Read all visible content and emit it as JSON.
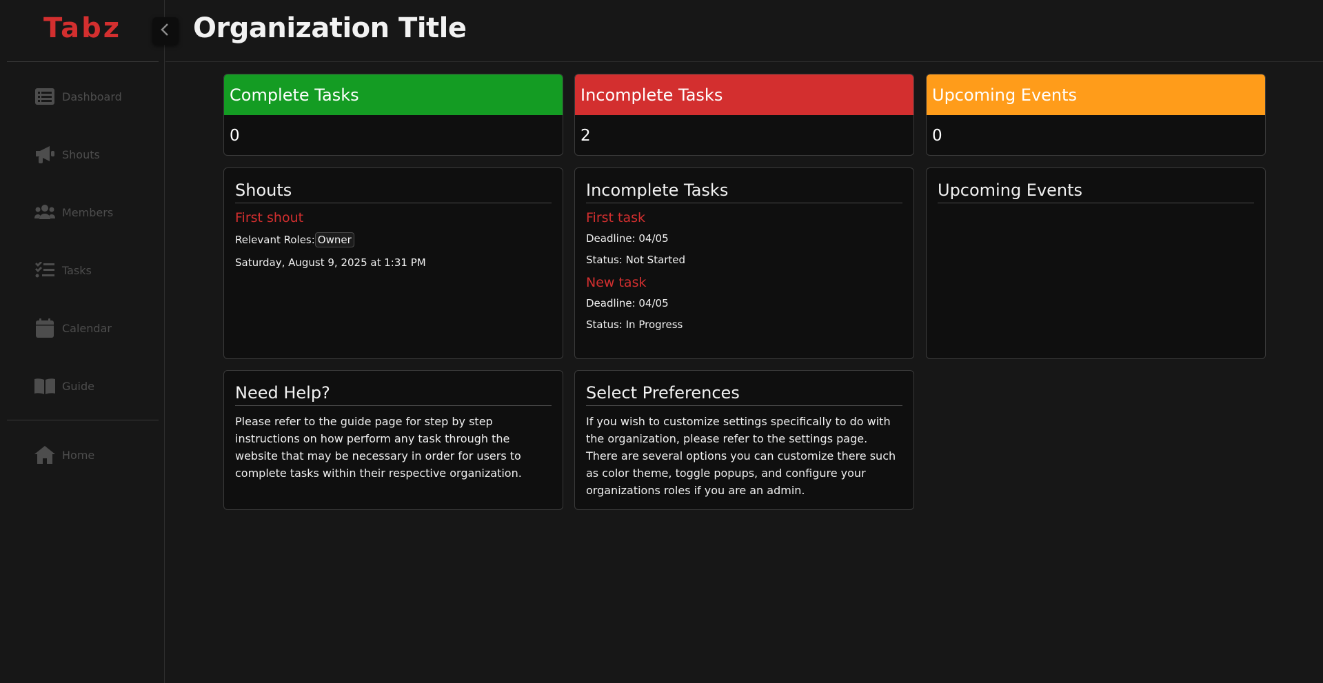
{
  "brand": "Tabz",
  "header": {
    "title": "Organization Title"
  },
  "sidebar": {
    "items": [
      {
        "label": "Dashboard",
        "icon": "list-icon"
      },
      {
        "label": "Shouts",
        "icon": "megaphone-icon"
      },
      {
        "label": "Members",
        "icon": "users-icon"
      },
      {
        "label": "Tasks",
        "icon": "checklist-icon"
      },
      {
        "label": "Calendar",
        "icon": "calendar-icon"
      },
      {
        "label": "Guide",
        "icon": "book-icon"
      }
    ],
    "home": {
      "label": "Home",
      "icon": "home-icon"
    }
  },
  "stats": [
    {
      "title": "Complete Tasks",
      "value": "0",
      "color": "#149c23"
    },
    {
      "title": "Incomplete Tasks",
      "value": "2",
      "color": "#d32f2f"
    },
    {
      "title": "Upcoming Events",
      "value": "0",
      "color": "#ff9c1a"
    }
  ],
  "shouts_panel": {
    "title": "Shouts",
    "items": [
      {
        "title": "First shout",
        "roles_label": "Relevant Roles:",
        "role": "Owner",
        "date": "Saturday, August 9, 2025 at 1:31 PM"
      }
    ]
  },
  "tasks_panel": {
    "title": "Incomplete Tasks",
    "items": [
      {
        "title": "First task",
        "deadline": "Deadline: 04/05",
        "status": "Status: Not Started"
      },
      {
        "title": "New task",
        "deadline": "Deadline: 04/05",
        "status": "Status: In Progress"
      }
    ]
  },
  "events_panel": {
    "title": "Upcoming Events"
  },
  "help_panel": {
    "title": "Need Help?",
    "text": "Please refer to the guide page for step by step instructions on how perform any task through the website that may be necessary in order for users to complete tasks within their respective organization."
  },
  "prefs_panel": {
    "title": "Select Preferences",
    "text": "If you wish to customize settings specifically to do with the organization, please refer to the settings page. There are several options you can customize there such as color theme, toggle popups, and configure your organizations roles if you are an admin."
  },
  "colors": {
    "accent": "#d32f2f",
    "background": "#171717",
    "panel": "#0f0f0f"
  }
}
